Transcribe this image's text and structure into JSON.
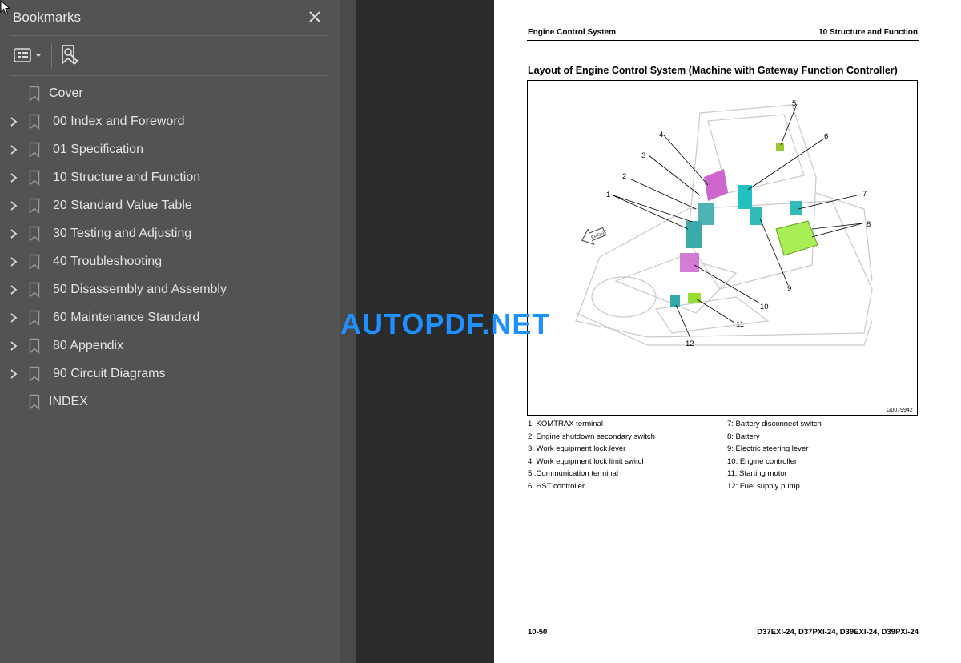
{
  "sidebar": {
    "title": "Bookmarks",
    "items": [
      {
        "label": "Cover",
        "expandable": false
      },
      {
        "label": "00 Index and Foreword",
        "expandable": true
      },
      {
        "label": "01 Specification",
        "expandable": true
      },
      {
        "label": "10 Structure and Function",
        "expandable": true
      },
      {
        "label": "20 Standard Value Table",
        "expandable": true
      },
      {
        "label": "30 Testing and Adjusting",
        "expandable": true
      },
      {
        "label": "40 Troubleshooting",
        "expandable": true
      },
      {
        "label": "50 Disassembly and Assembly",
        "expandable": true
      },
      {
        "label": "60 Maintenance Standard",
        "expandable": true
      },
      {
        "label": "80 Appendix",
        "expandable": true
      },
      {
        "label": "90 Circuit Diagrams",
        "expandable": true
      },
      {
        "label": "INDEX",
        "expandable": false
      }
    ]
  },
  "watermark": "AUTOPDF.NET",
  "page": {
    "header_left": "Engine Control System",
    "header_right": "10 Structure and Function",
    "figure_title": "Layout of Engine Control System (Machine with Gateway Function Controller)",
    "figure_code": "G0079942",
    "callouts": [
      "1",
      "2",
      "3",
      "4",
      "5",
      "6",
      "7",
      "8",
      "9",
      "10",
      "11",
      "12"
    ],
    "front_label": "FRONT",
    "legend_left": [
      "1: KOMTRAX terminal",
      "2: Engine shutdown secondary switch",
      "3: Work equipment lock lever",
      "4: Work equipment lock limit switch",
      "5 :Communication terminal",
      "6: HST controller"
    ],
    "legend_right": [
      "7: Battery disconnect switch",
      "8: Battery",
      "9: Electric steering lever",
      "10: Engine controller",
      "11: Starting motor",
      "12: Fuel supply pump"
    ],
    "footer_left": "10-50",
    "footer_right": "D37EXI-24, D37PXI-24, D39EXI-24, D39PXI-24"
  },
  "colors": {
    "sidebar_bg": "#535353",
    "gutter_bg": "#2b2b2b",
    "watermark": "#1e90ff"
  }
}
